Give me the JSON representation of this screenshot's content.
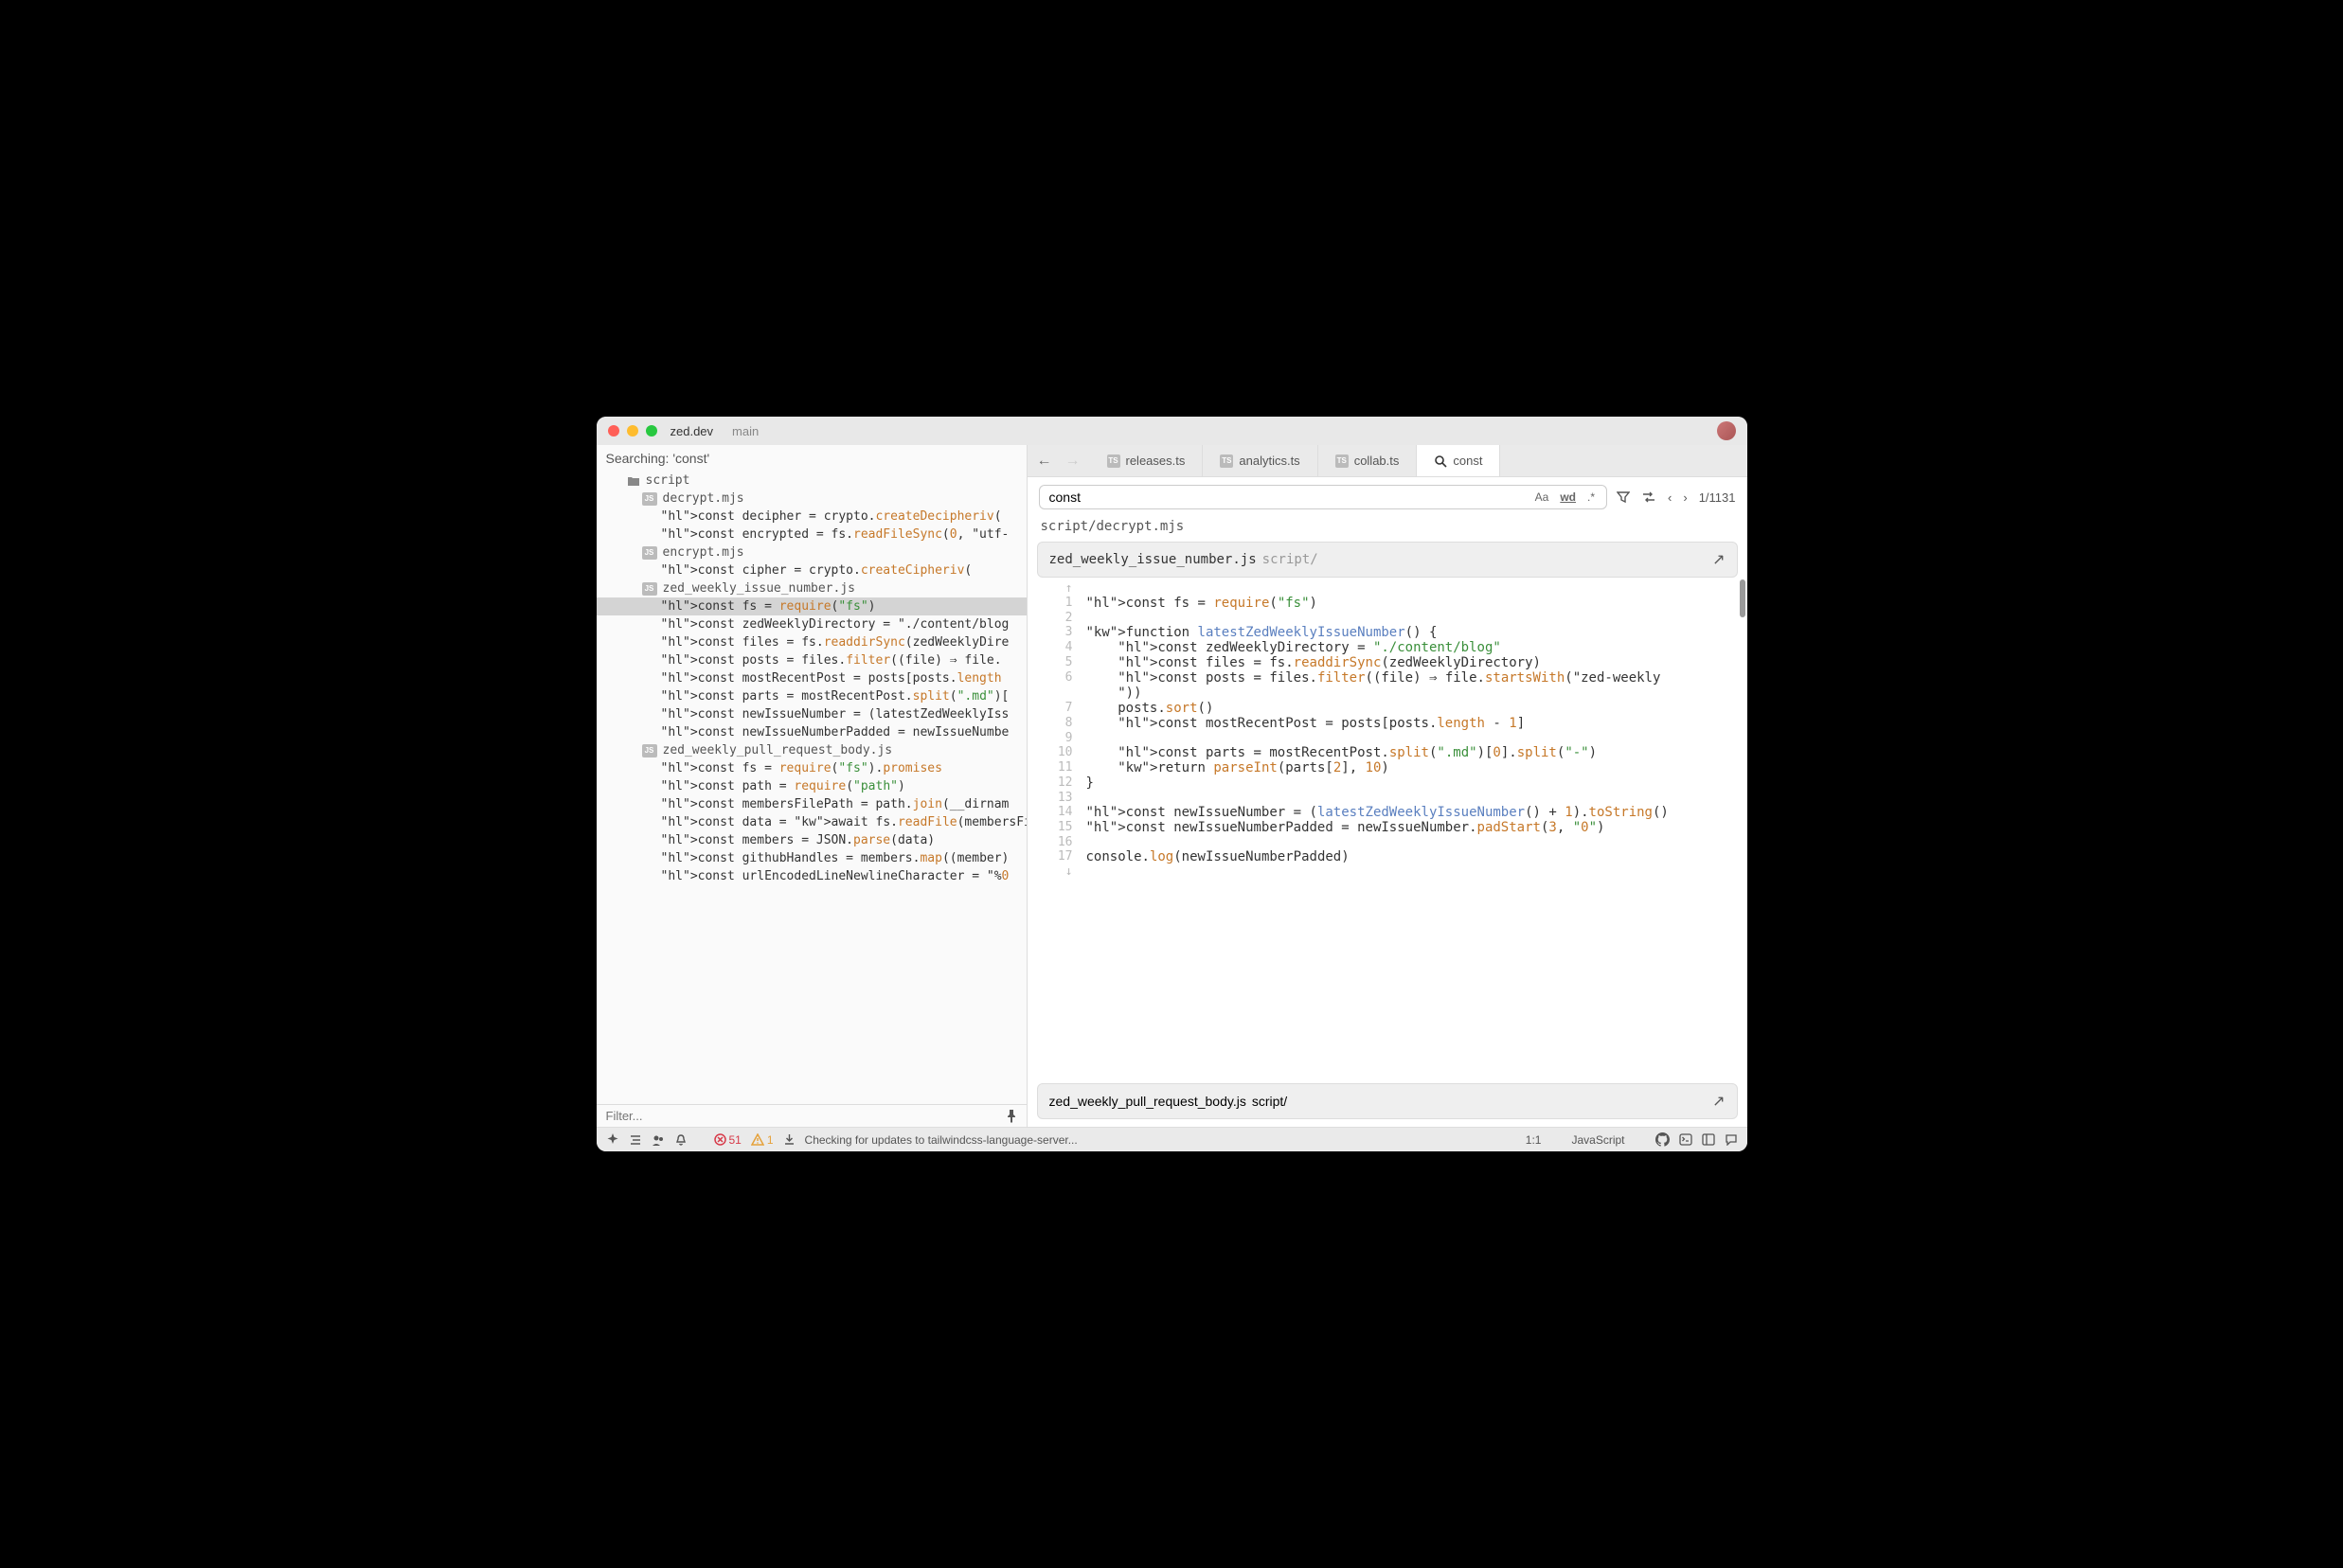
{
  "titlebar": {
    "title": "zed.dev",
    "branch": "main"
  },
  "left": {
    "header": "Searching: 'const'",
    "folder": "script",
    "files": [
      {
        "name": "decrypt.mjs",
        "matches": [
          "const decipher = crypto.createDecipheriv(",
          "const encrypted = fs.readFileSync(0, \"utf-"
        ]
      },
      {
        "name": "encrypt.mjs",
        "matches": [
          "const cipher = crypto.createCipheriv("
        ]
      },
      {
        "name": "zed_weekly_issue_number.js",
        "matches": [
          "const fs = require(\"fs\")",
          "const zedWeeklyDirectory = \"./content/blog",
          "const files = fs.readdirSync(zedWeeklyDire",
          "const posts = files.filter((file) => file.",
          "const mostRecentPost = posts[posts.length",
          "const parts = mostRecentPost.split(\".md\")[",
          "const newIssueNumber = (latestZedWeeklyIss",
          "const newIssueNumberPadded = newIssueNumbe"
        ],
        "selected": 0
      },
      {
        "name": "zed_weekly_pull_request_body.js",
        "matches": [
          "const fs = require(\"fs\").promises",
          "const path = require(\"path\")",
          "const membersFilePath = path.join(__dirnam",
          "const data = await fs.readFile(membersFile",
          "const members = JSON.parse(data)",
          "const githubHandles = members.map((member)",
          "const urlEncodedLineNewlineCharacter = \"%0"
        ]
      }
    ],
    "filter_placeholder": "Filter..."
  },
  "tabs": {
    "items": [
      "releases.ts",
      "analytics.ts",
      "collab.ts"
    ],
    "search_tab": "const"
  },
  "search": {
    "query": "const",
    "count": "1/1131",
    "opt_aa": "Aa",
    "opt_wd": "wd",
    "opt_regex": ".*"
  },
  "breadcrumb": "script/decrypt.mjs",
  "result1": {
    "file": "zed_weekly_issue_number.js",
    "path": "script/"
  },
  "result2": {
    "file": "zed_weekly_pull_request_body.js",
    "path": "script/"
  },
  "code": {
    "lines": [
      {
        "n": "↑",
        "t": ""
      },
      {
        "n": "1",
        "t": "const fs = require(\"fs\")"
      },
      {
        "n": "2",
        "t": ""
      },
      {
        "n": "3",
        "t": "function latestZedWeeklyIssueNumber() {"
      },
      {
        "n": "4",
        "t": "    const zedWeeklyDirectory = \"./content/blog\""
      },
      {
        "n": "5",
        "t": "    const files = fs.readdirSync(zedWeeklyDirectory)"
      },
      {
        "n": "6",
        "t": "    const posts = files.filter((file) => file.startsWith(\"zed-weekly"
      },
      {
        "n": "",
        "t": "    \"))"
      },
      {
        "n": "7",
        "t": "    posts.sort()"
      },
      {
        "n": "8",
        "t": "    const mostRecentPost = posts[posts.length - 1]"
      },
      {
        "n": "9",
        "t": ""
      },
      {
        "n": "10",
        "t": "    const parts = mostRecentPost.split(\".md\")[0].split(\"-\")"
      },
      {
        "n": "11",
        "t": "    return parseInt(parts[2], 10)"
      },
      {
        "n": "12",
        "t": "}"
      },
      {
        "n": "13",
        "t": ""
      },
      {
        "n": "14",
        "t": "const newIssueNumber = (latestZedWeeklyIssueNumber() + 1).toString()"
      },
      {
        "n": "15",
        "t": "const newIssueNumberPadded = newIssueNumber.padStart(3, \"0\")"
      },
      {
        "n": "16",
        "t": ""
      },
      {
        "n": "17",
        "t": "console.log(newIssueNumberPadded)"
      },
      {
        "n": "↓",
        "t": ""
      }
    ]
  },
  "status": {
    "errors": "51",
    "warnings": "1",
    "msg": "Checking for updates to tailwindcss-language-server...",
    "pos": "1:1",
    "lang": "JavaScript"
  }
}
